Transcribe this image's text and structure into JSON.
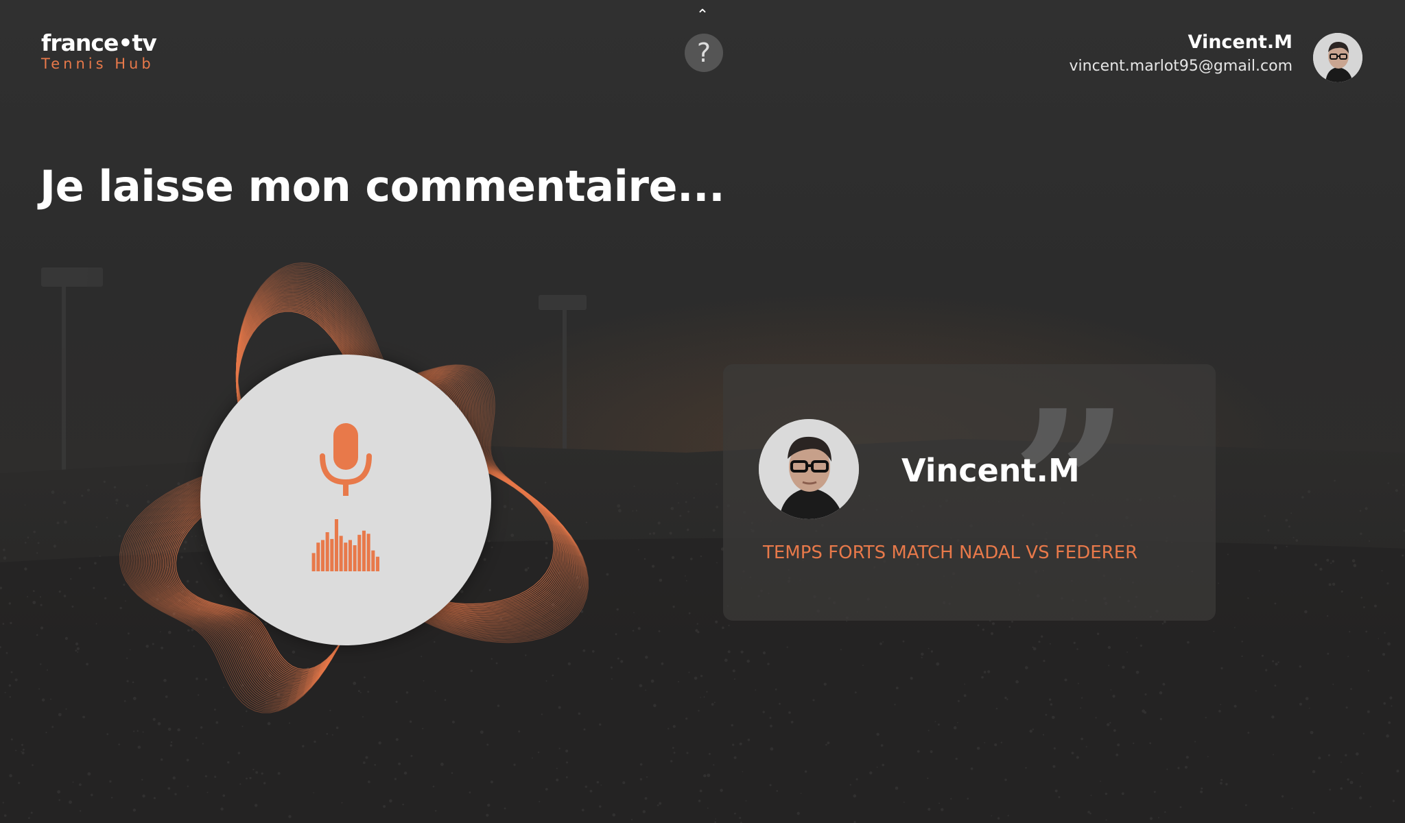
{
  "app": {
    "logo_main": "france•tv",
    "logo_sub": "Tennis Hub"
  },
  "header": {
    "scroll_up_glyph": "⌃",
    "help_glyph": "?",
    "user_name": "Vincent.M",
    "user_email": "vincent.marlot95@gmail.com"
  },
  "main": {
    "title": "Je laisse mon commentaire..."
  },
  "comment_card": {
    "author": "Vincent.M",
    "video_title": "TEMPS FORTS MATCH NADAL VS FEDERER",
    "quote_glyph": "”"
  },
  "colors": {
    "accent": "#e8794a",
    "card_bg": "#3c3a39",
    "mic_circle": "#dcdcdc"
  },
  "icons": {
    "microphone": "microphone-icon",
    "waveform": "audio-waveform-icon",
    "help": "question-mark-icon",
    "scroll_up": "chevron-up-icon"
  },
  "audio_level": {
    "bars": [
      0.35,
      0.55,
      0.6,
      0.75,
      0.62,
      1.0,
      0.68,
      0.55,
      0.6,
      0.5,
      0.7,
      0.78,
      0.72,
      0.4,
      0.28
    ]
  }
}
